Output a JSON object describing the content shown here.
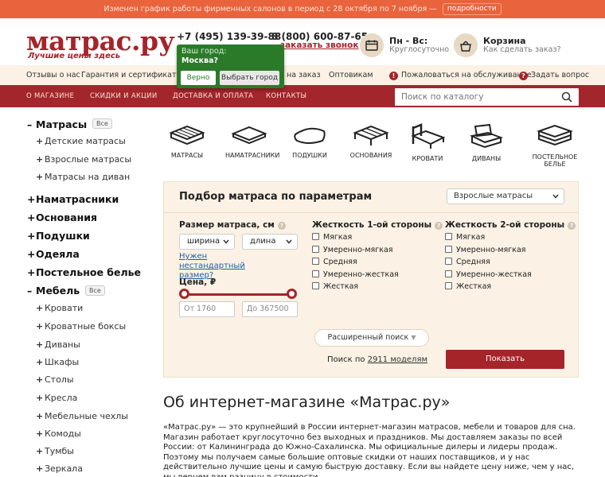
{
  "notice": {
    "text": "Изменен график работы фирменных салонов в период с 28 октября по 7 ноября —",
    "button": "подробности"
  },
  "header": {
    "logo": "матрас.ру",
    "tagline": "Лучшие цены здесь",
    "phone1": "+7 (495) 139-39-88",
    "phone2": "8 (800) 600-87-65",
    "callback": "заказать звонок",
    "hours_title": "Пн - Вс:",
    "hours_sub": "Круглосуточно",
    "cart_title": "Корзина",
    "cart_sub": "Как сделать заказ?"
  },
  "city_popup": {
    "question": "Ваш город:",
    "city": "Москва?",
    "confirm": "Верно",
    "choose": "Выбрать город"
  },
  "links": {
    "reviews": "Отзывы о нас",
    "guarantee": "Гарантия и сертификаты",
    "on_order": "на заказ",
    "wholesale": "Оптовикам",
    "complain": "Пожаловаться на обслуживание",
    "ask": "Задать вопрос"
  },
  "nav": {
    "items": [
      "О МАГАЗИНЕ",
      "СКИДКИ И АКЦИИ",
      "ДОСТАВКА И ОПЛАТА",
      "КОНТАКТЫ"
    ],
    "search_placeholder": "Поиск по каталогу"
  },
  "sidebar": {
    "all_label": "Все",
    "mattresses": "Матрасы",
    "mattress_subs": [
      "Детские матрасы",
      "Взрослые матрасы",
      "Матрасы на диван"
    ],
    "cats": [
      "Наматрасники",
      "Основания",
      "Подушки",
      "Одеяла",
      "Постельное белье"
    ],
    "furniture": "Мебель",
    "furniture_subs": [
      "Кровати",
      "Кроватные боксы",
      "Диваны",
      "Шкафы",
      "Столы",
      "Кресла",
      "Мебельные чехлы",
      "Комоды",
      "Тумбы",
      "Зеркала"
    ]
  },
  "categories": [
    "МАТРАСЫ",
    "НАМАТРАСНИКИ",
    "ПОДУШКИ",
    "ОСНОВАНИЯ",
    "КРОВАТИ",
    "ДИВАНЫ",
    "ПОСТЕЛЬНОЕ",
    "БЕЛЬЕ"
  ],
  "filter": {
    "title": "Подбор матраса по параметрам",
    "type_select": "Взрослые матрасы",
    "size_label": "Размер матраса, см",
    "width": "ширина",
    "length": "длина",
    "nonstandard": "Нужен нестандартный размер?",
    "price_label": "Цена, ₽",
    "price_from": "От 1760",
    "price_to": "До 367500",
    "side1_label": "Жесткость 1-ой стороны",
    "side2_label": "Жесткость 2-ой стороны",
    "hardness": [
      "Мягкая",
      "Умеренно-мягкая",
      "Средняя",
      "Умеренно-жесткая",
      "Жесткая"
    ],
    "advanced": "Расширенный поиск",
    "search_prefix": "Поиск по",
    "models": "2911 моделям",
    "show": "Показать"
  },
  "about": {
    "title": "Об интернет-магазине «Матрас.ру»",
    "text": "«Матрас.ру» — это крупнейший в России интернет-магазин матрасов, мебели и товаров для сна. Магазин работает круглосуточно без выходных и праздников. Мы доставляем заказы по всей России: от Калининграда до Южно-Сахалинска. Мы официальные дилеры и лидеры продаж. Поэтому мы получаем самые большие оптовые скидки от наших поставщиков, и у нас действительно лучшие цены и самую быструю доставку. Если вы найдете цену ниже, чем у нас, мы вернем вам разницу в стоимости."
  },
  "colors": {
    "brand": "#a5242a",
    "notice": "#e9633c",
    "popup": "#2b7a2a",
    "panel": "#fbf1e4"
  }
}
